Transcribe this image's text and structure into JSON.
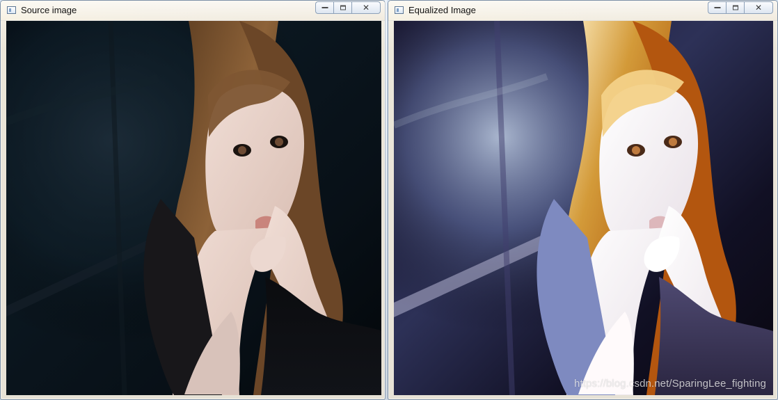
{
  "windows": {
    "source": {
      "title": "Source image"
    },
    "equalized": {
      "title": "Equalized Image",
      "watermark": "https://blog.csdn.net/SparingLee_fighting"
    }
  },
  "controls": {
    "minimize_icon": "minimize-icon",
    "maximize_icon": "maximize-icon",
    "close_glyph": "✕"
  },
  "colors": {
    "window_border": "#7b8fa6",
    "title_bar": "#f1ebde",
    "image_background": "#000000"
  }
}
